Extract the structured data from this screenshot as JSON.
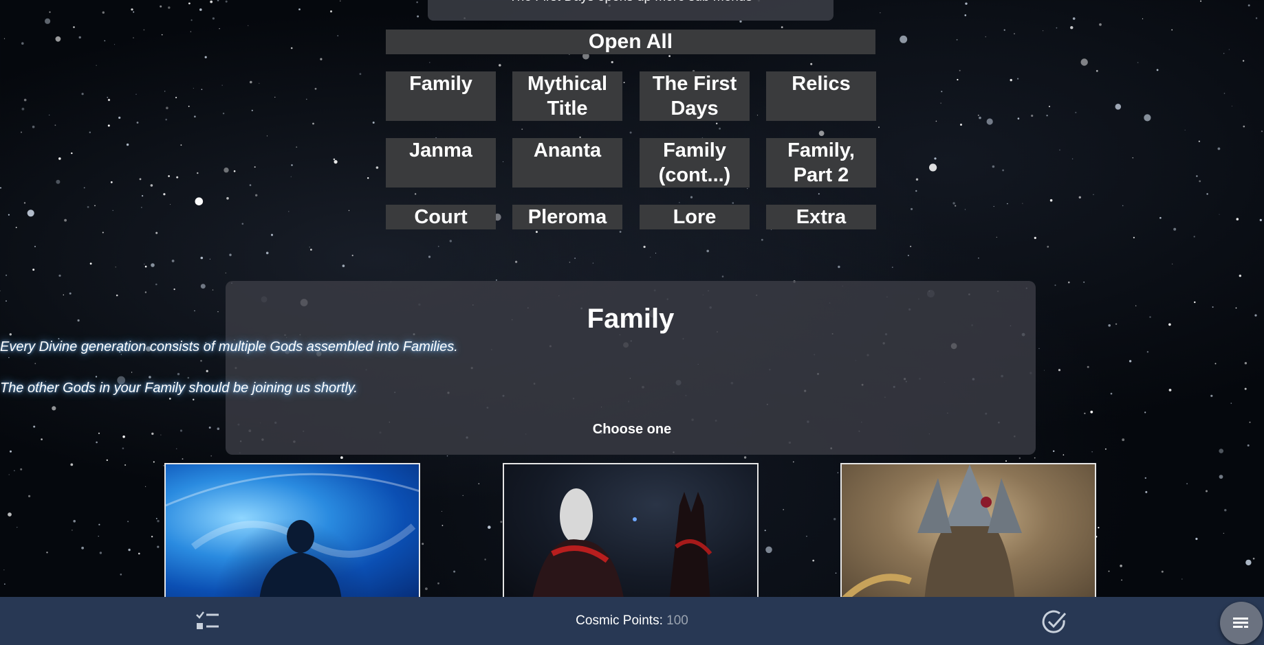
{
  "hint": "The First Days opens up more sub menus",
  "open_all_label": "Open All",
  "tabs": [
    "Family",
    "Mythical Title",
    "The First Days",
    "Relics",
    "Janma",
    "Ananta",
    "Family (cont...)",
    "Family, Part 2",
    "Court",
    "Pleroma",
    "Lore",
    "Extra"
  ],
  "section": {
    "title": "Family",
    "desc1": "Every Divine generation consists of multiple Gods assembled into Families.",
    "desc2": "The other Gods in your Family should be joining us shortly.",
    "choose": "Choose one"
  },
  "cards": [
    {
      "icon": "earth-silhouette-image"
    },
    {
      "icon": "dark-figures-image"
    },
    {
      "icon": "armored-deity-image"
    }
  ],
  "bottom_bar": {
    "points_label": "Cosmic Points:",
    "points_value": "100",
    "left_icon": "checklist-icon",
    "right_icon": "check-circle-icon",
    "fab_icon": "menu-list-icon"
  }
}
